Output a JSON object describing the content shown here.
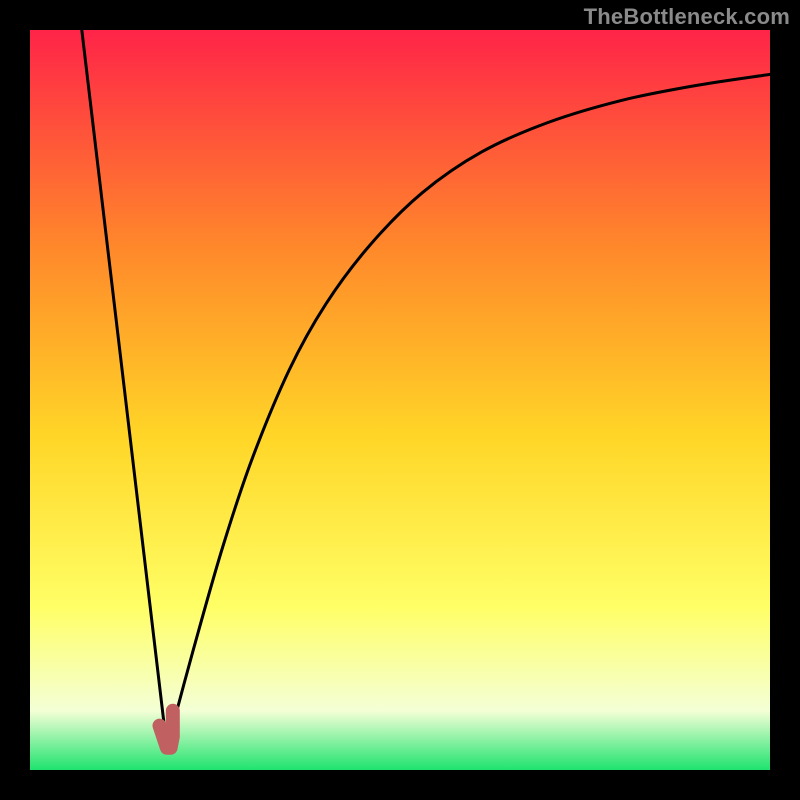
{
  "watermark": "TheBottleneck.com",
  "colors": {
    "gradient_top": "#ff2448",
    "gradient_mid1": "#ff8a2a",
    "gradient_mid2": "#ffd627",
    "gradient_mid3": "#ffff66",
    "gradient_bottom_pale": "#f4ffd6",
    "gradient_green": "#1ee36f",
    "curve_stroke": "#000000",
    "salmon_mark": "#c06060",
    "frame_bg": "#000000"
  },
  "chart_data": {
    "type": "line",
    "title": "",
    "xlabel": "",
    "ylabel": "",
    "xlim": [
      0,
      100
    ],
    "ylim": [
      0,
      100
    ],
    "series": [
      {
        "name": "left-descent",
        "x": [
          7,
          18.5
        ],
        "y": [
          100,
          3
        ]
      },
      {
        "name": "right-rise",
        "x": [
          18.5,
          22,
          26,
          30,
          35,
          40,
          46,
          53,
          61,
          70,
          80,
          90,
          100
        ],
        "y": [
          3,
          16,
          30,
          42,
          54,
          63,
          71,
          78,
          83.5,
          87.5,
          90.5,
          92.5,
          94
        ]
      },
      {
        "name": "min-mark",
        "x": [
          17.5,
          18.5,
          19,
          19.3,
          19.3
        ],
        "y": [
          6,
          3,
          3,
          4.5,
          8
        ]
      }
    ]
  }
}
